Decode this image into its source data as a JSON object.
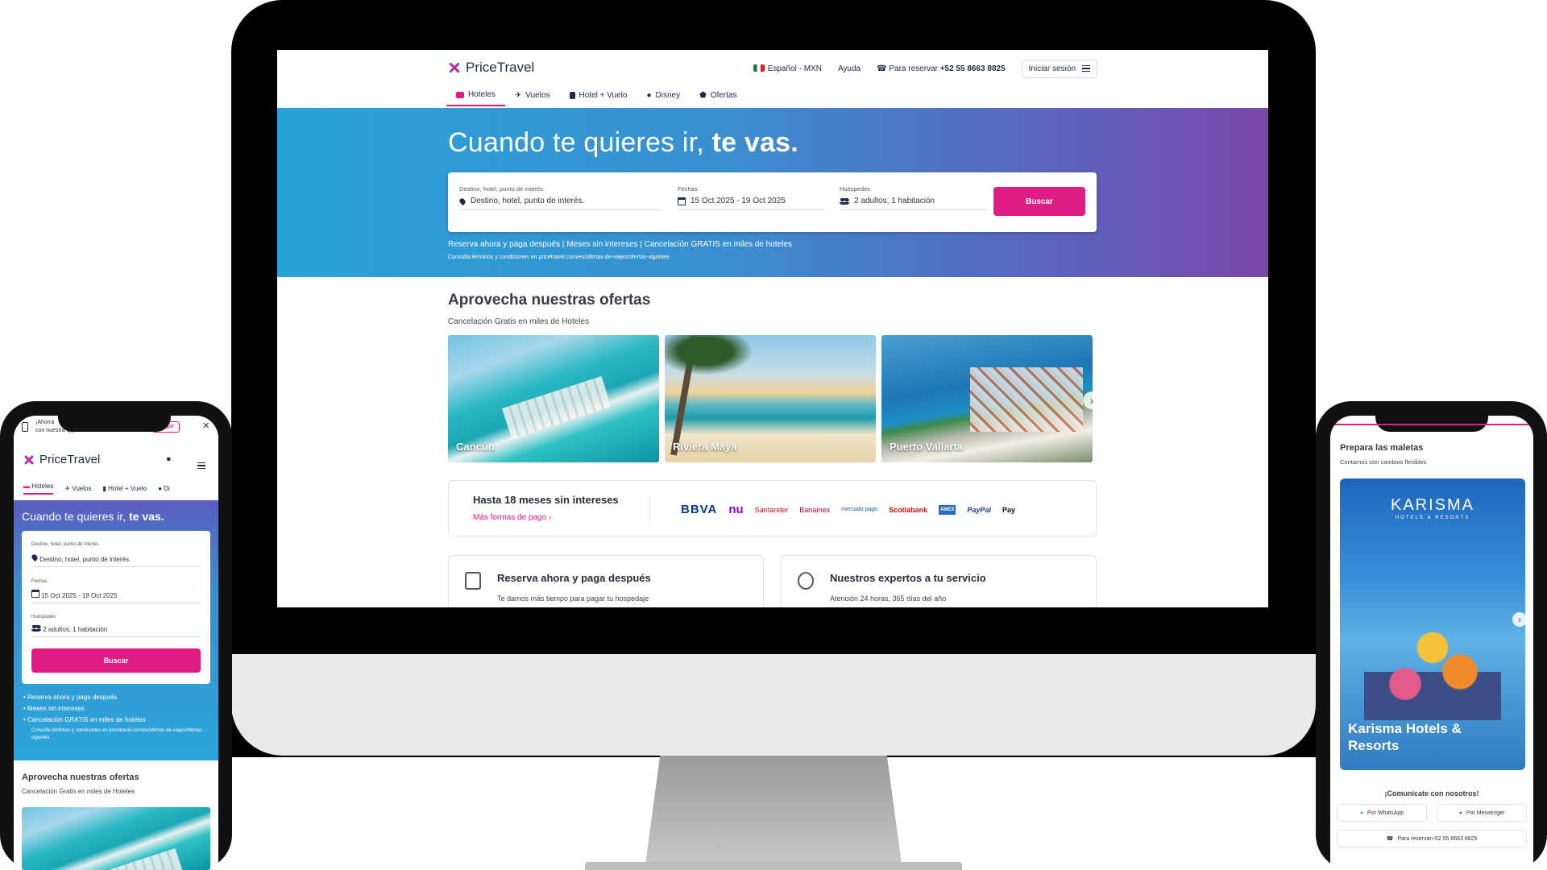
{
  "brand": {
    "name": "PriceTravel",
    "accent": "#e01d84",
    "navy": "#1c2b4a"
  },
  "desktop": {
    "topbar": {
      "language": "Español - MXN",
      "help": "Ayuda",
      "reserve_label": "Para reservar",
      "reserve_phone": "+52 55 8663 8825",
      "login": "Iniciar sesión"
    },
    "tabs": [
      {
        "label": "Hoteles",
        "icon": "bed-icon",
        "active": true
      },
      {
        "label": "Vuelos",
        "icon": "plane-icon"
      },
      {
        "label": "Hotel + Vuelo",
        "icon": "luggage-icon"
      },
      {
        "label": "Disney",
        "icon": "mickey-icon"
      },
      {
        "label": "Ofertas",
        "icon": "tag-icon"
      }
    ],
    "hero": {
      "title_regular": "Cuando te quieres ir,",
      "title_bold": "te vas.",
      "destination_label": "Destino, hotel, punto de interés.",
      "destination_placeholder": "Destino, hotel, punto de interés.",
      "dates_label": "Fechas",
      "dates_value": "15 Oct 2025 - 19 Oct 2025",
      "guests_label": "Huéspedes",
      "guests_value": "2 adultos, 1 habitación",
      "search_button": "Buscar",
      "promo": "Reserva ahora y paga después | Meses sin intereses | Cancelación GRATIS en miles de hoteles",
      "terms": "Consulta términos y condiciones en pricetravel.com/es/ofertas-de-viajes/ofertas-vigentes"
    },
    "offers": {
      "title": "Aprovecha nuestras ofertas",
      "subtitle": "Cancelación Gratis en miles de Hoteles",
      "destinations": [
        "Cancún",
        "Riviera Maya",
        "Puerto Vallarta"
      ]
    },
    "payments": {
      "title": "Hasta 18 meses sin intereses",
      "link": "Más formas de pago",
      "banks": [
        "BBVA",
        "nu",
        "Santander",
        "Banamex",
        "mercado pago",
        "Scotiabank",
        "AMEX",
        "PayPal",
        "Pay"
      ]
    },
    "features": [
      {
        "title": "Reserva ahora y paga después",
        "subtitle": "Te damos más tiempo para pagar tu hospedaje"
      },
      {
        "title": "Nuestros expertos a tu servicio",
        "subtitle": "Atención 24 horas, 365 días del año"
      }
    ]
  },
  "left_phone": {
    "banner_line1": "¡Ahorra",
    "banner_line2": "con nuestra app!",
    "banner_button": "cargar",
    "tabs": [
      "Hoteles",
      "Vuelos",
      "Hotel + Vuelo",
      "Di"
    ],
    "hero_title_regular": "Cuando te quieres ir,",
    "hero_title_bold": "te vas.",
    "destination_label": "Destino, hotel, punto de interés.",
    "destination_placeholder": "Destino, hotel, punto de interés.",
    "dates_label": "Fechas",
    "dates_value": "15 Oct 2025 - 19 Oct 2025",
    "guests_label": "Huéspedes",
    "guests_value": "2 adultos, 1 habitación",
    "search_button": "Buscar",
    "bullets": [
      "Reserva ahora y paga después",
      "Meses sin intereses",
      "Cancelación GRATIS en miles de hoteles"
    ],
    "terms": "Consulta términos y condiciones en pricetravel.com/es/ofertas-de-viajes/ofertas-vigentes",
    "offers_title": "Aprovecha nuestras ofertas",
    "offers_subtitle": "Cancelación Gratis en miles de Hoteles"
  },
  "right_phone": {
    "title": "Prepara las maletas",
    "subtitle": "Contamos con cambios flexibles",
    "card_logo": "KARISMA",
    "card_logo_sub": "HOTELS & RESORTS",
    "card_title": "Karisma Hotels & Resorts",
    "contact_title": "¡Comunícate con nosotros!",
    "whatsapp": "Por WhatsApp",
    "messenger": "Por Messenger",
    "reserve": "Para reservar+52 55 8663 8825"
  }
}
